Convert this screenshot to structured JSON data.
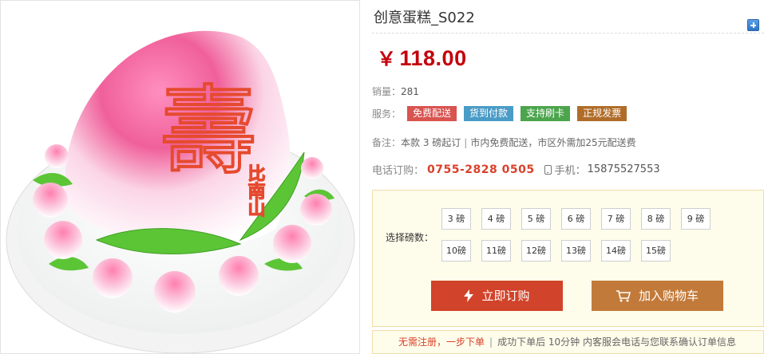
{
  "product": {
    "title": "创意蛋糕_S022",
    "currency": "￥",
    "price": "118.00"
  },
  "sales": {
    "label": "销量：",
    "value": "281"
  },
  "services": {
    "label": "服务：",
    "tags": [
      "免费配送",
      "货到付款",
      "支持刷卡",
      "正规发票"
    ]
  },
  "note": {
    "label": "备注：",
    "text_a": "本款 3 磅起订",
    "sep": "|",
    "text_b": "市内免费配送，市区外需加25元配送费"
  },
  "phones": {
    "phone_label": "电话订购：",
    "phone": "0755-2828 0505",
    "mobile_label": "手机：",
    "mobile": "15875527553"
  },
  "selection": {
    "label": "选择磅数：",
    "weights": [
      "3 磅",
      "4 磅",
      "5 磅",
      "6 磅",
      "7 磅",
      "8 磅",
      "9 磅",
      "10磅",
      "11磅",
      "12磅",
      "13磅",
      "14磅",
      "15磅"
    ],
    "buy_label": "立即订购",
    "cart_label": "加入购物车"
  },
  "footer": {
    "highlight": "无需注册，一步下单",
    "sep": "|",
    "text": "成功下单后 10分钟 内客服会电话与您联系确认订单信息"
  },
  "image": {
    "cake_text": "壽",
    "side_text": "比南山",
    "colors": {
      "peach_pink": "#f0609a",
      "leaf_green": "#4fbf2e",
      "icing": "#e64a2e"
    }
  }
}
